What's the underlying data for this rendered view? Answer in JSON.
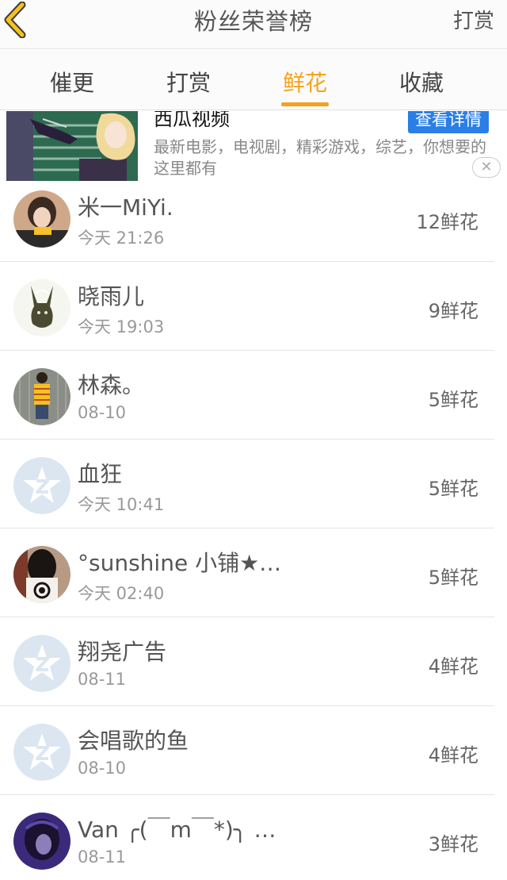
{
  "header": {
    "title": "粉丝荣誉榜",
    "right_action": "打赏",
    "back_icon": "chevron-left-icon"
  },
  "tabs": [
    {
      "label": "催更",
      "active": false
    },
    {
      "label": "打赏",
      "active": false
    },
    {
      "label": "鲜花",
      "active": true
    },
    {
      "label": "收藏",
      "active": false
    }
  ],
  "ad": {
    "title": "西瓜视频",
    "cta": "查看详情",
    "description": "最新电影，电视剧，精彩游戏，综艺，你想要的这里都有",
    "close_label": "✕"
  },
  "fans": [
    {
      "name": "米一MiYi.",
      "time": "今天 21:26",
      "count": "12鲜花"
    },
    {
      "name": "晓雨儿",
      "time": "今天 19:03",
      "count": "9鲜花"
    },
    {
      "name": "林森。",
      "time": "08-10",
      "count": "5鲜花"
    },
    {
      "name": "血狂",
      "time": "今天 10:41",
      "count": "5鲜花"
    },
    {
      "name": "°sunshine 小铺★…",
      "time": "今天 02:40",
      "count": "5鲜花"
    },
    {
      "name": "翔尧广告",
      "time": "08-11",
      "count": "4鲜花"
    },
    {
      "name": "会唱歌的鱼",
      "time": "08-10",
      "count": "4鲜花"
    },
    {
      "name": "Van ╭(￣m￣*)╮ …",
      "time": "08-11",
      "count": "3鲜花"
    }
  ],
  "colors": {
    "accent": "#f5a21c",
    "cta_blue": "#2a7ee6",
    "back_arrow": "#f5c21c"
  }
}
